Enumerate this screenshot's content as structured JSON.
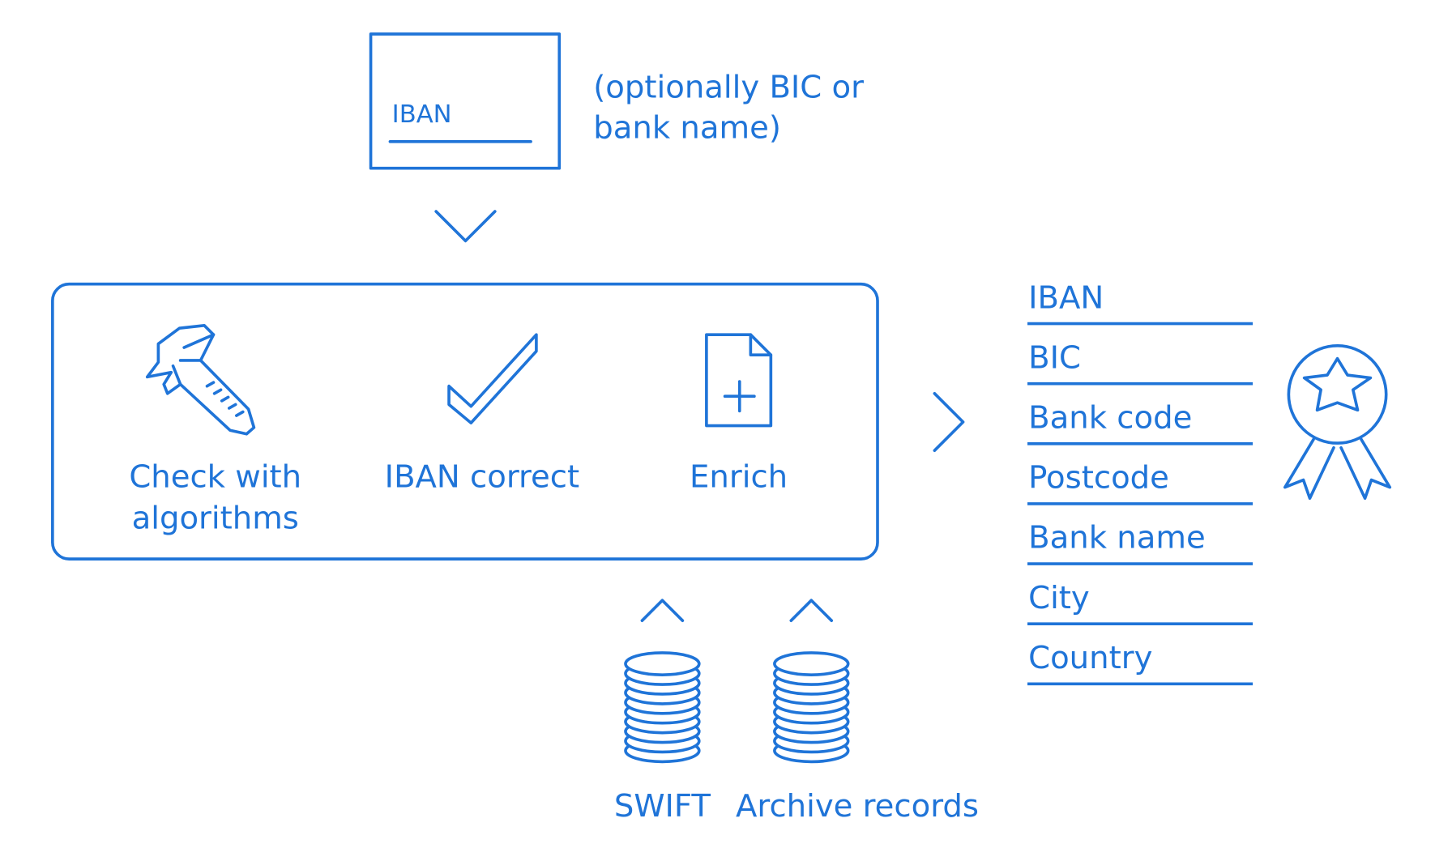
{
  "color": "#1f74d8",
  "input": {
    "field_label": "IBAN",
    "note_line1": "(optionally BIC or",
    "note_line2": "bank name)"
  },
  "process": {
    "steps": [
      {
        "icon": "caliper-icon",
        "label_line1": "Check with",
        "label_line2": "algorithms"
      },
      {
        "icon": "checkmark-icon",
        "label_line1": "IBAN correct"
      },
      {
        "icon": "document-plus-icon",
        "label_line1": "Enrich"
      }
    ]
  },
  "sources": [
    {
      "icon": "database-icon",
      "label": "SWIFT"
    },
    {
      "icon": "database-icon",
      "label": "Archive records"
    }
  ],
  "output": {
    "fields": [
      "IBAN",
      "BIC",
      "Bank code",
      "Postcode",
      "Bank name",
      "City",
      "Country"
    ],
    "badge_icon": "award-ribbon-icon"
  }
}
